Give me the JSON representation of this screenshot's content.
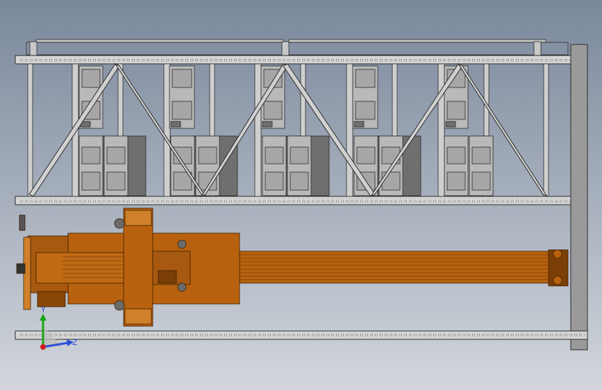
{
  "viewport": {
    "background_top": "#7a889c",
    "background_bottom": "#d2d6dc"
  },
  "colors": {
    "steel_stroke": "#2a2a2a",
    "steel_fill": "#c9c9c9",
    "steel_dark": "#8a8a8a",
    "box_fill": "#b9b9b9",
    "box_dark": "#6f6f6f",
    "orange": "#b8620f",
    "orange_dark": "#7a3e06",
    "orange_light": "#d0802a",
    "axis_x": "#d11c1c",
    "axis_y": "#19a619",
    "axis_z": "#2b4fd6"
  },
  "triad": {
    "y_label": "Y",
    "z_label": "Z"
  }
}
